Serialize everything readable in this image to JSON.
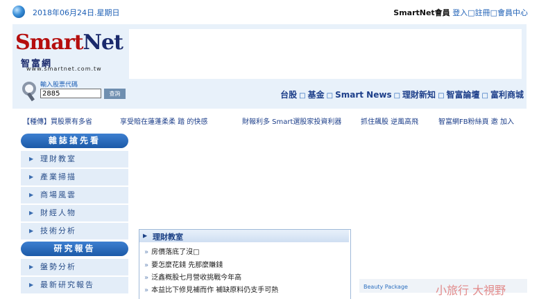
{
  "topbar": {
    "date": "2018年06月24日.星期日",
    "brand": "SmartNet會員",
    "login": "登入□",
    "register": "註冊□",
    "member_center": "會員中心"
  },
  "logo": {
    "wordmark_red": "Smart",
    "wordmark_navy": "Net",
    "chinese": "智富網",
    "url": "www.smartnet.com.tw"
  },
  "search": {
    "label": "輸入股票代碼",
    "value": "2885",
    "button": "查詢"
  },
  "main_nav": [
    "台股",
    "基金",
    "Smart News",
    "理財新知",
    "智富論壇",
    "富利商城"
  ],
  "ticker": [
    "【種傳】買股票有多省",
    "享受賠在蓮蓬柔柔 踏 的快感",
    "財報利多 Smart選股家投資利器",
    "抓住飆股 逆風高飛",
    "智富網FB粉絲頁 邀 加入"
  ],
  "sidebar": {
    "section1": "雜誌搶先看",
    "items1": [
      "理財教室",
      "產業掃描",
      "商場風雲",
      "財經人物",
      "技術分析"
    ],
    "section2": "研究報告",
    "items2": [
      "盤勢分析",
      "最新研究報告"
    ]
  },
  "articles": {
    "title": "理財教室",
    "items": [
      "房價落底了沒□",
      "要怎麼花錢 先那麼賺錢",
      "泛鑫概股七月營收挑戰今年高",
      "本益比下修見補而作 補缺原料仍支手可熱"
    ]
  },
  "ad": {
    "brand": "Beauty Package",
    "headline": "小旅行 大視野"
  }
}
